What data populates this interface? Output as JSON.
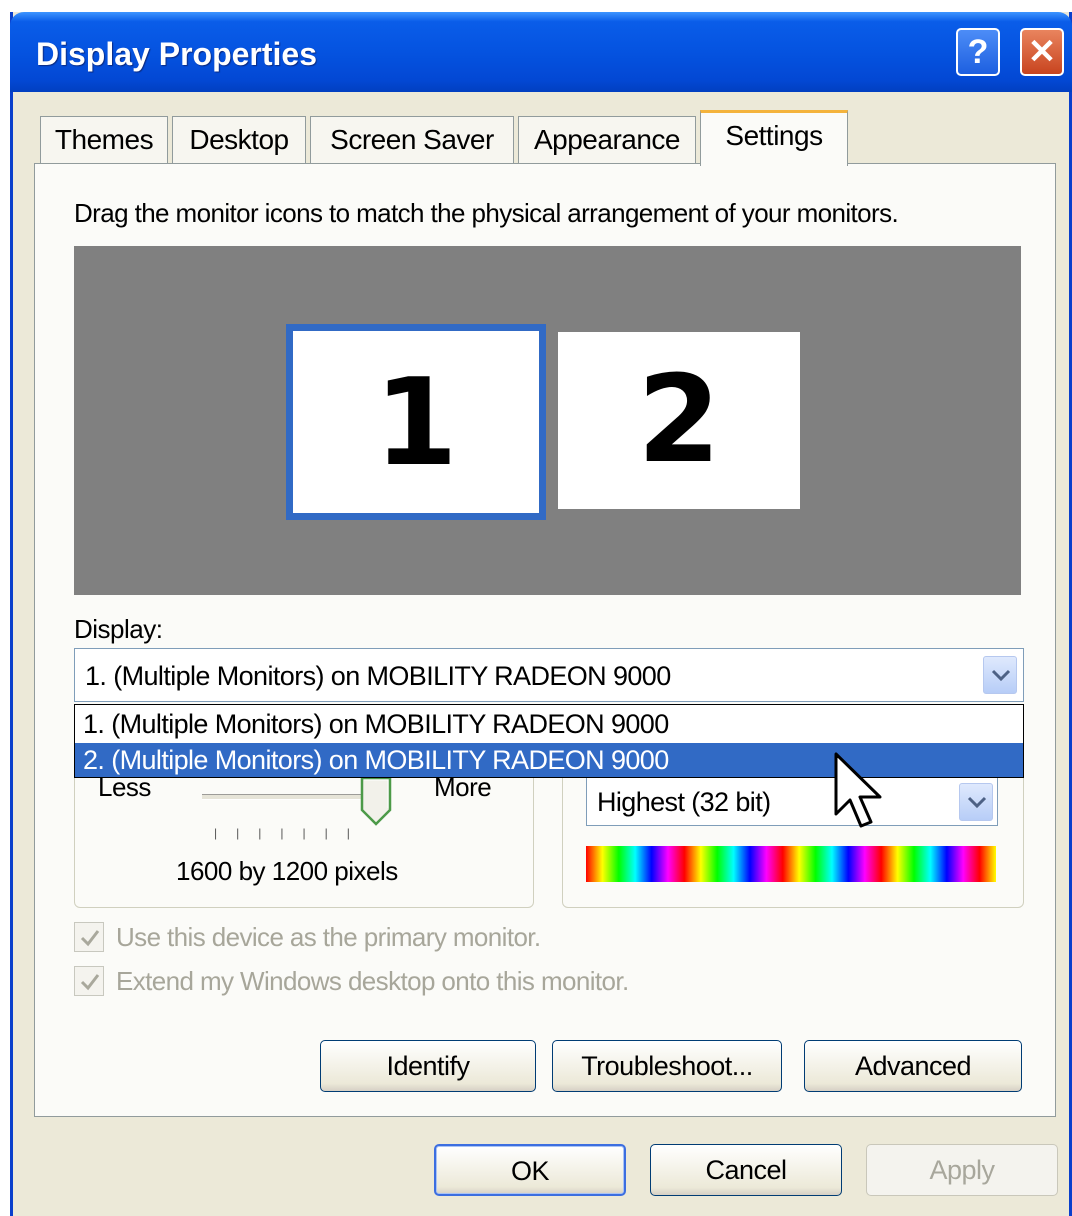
{
  "window": {
    "title": "Display Properties"
  },
  "titlebar_buttons": {
    "help": "?",
    "close": "✕"
  },
  "tabs": [
    "Themes",
    "Desktop",
    "Screen Saver",
    "Appearance",
    "Settings"
  ],
  "active_tab": "Settings",
  "instruction": "Drag the monitor icons to match the physical arrangement of your monitors.",
  "monitors": [
    "1",
    "2"
  ],
  "display": {
    "label": "Display:",
    "selected": "1. (Multiple Monitors) on MOBILITY RADEON 9000",
    "options": [
      "1. (Multiple Monitors) on MOBILITY RADEON 9000",
      "2. (Multiple Monitors) on MOBILITY RADEON 9000"
    ],
    "highlighted_option": "2. (Multiple Monitors) on MOBILITY RADEON 9000"
  },
  "resolution": {
    "less": "Less",
    "more": "More",
    "value": "1600 by 1200 pixels"
  },
  "color_quality": {
    "selected": "Highest (32 bit)"
  },
  "checkboxes": [
    {
      "label": "Use this device as the primary monitor.",
      "checked": true,
      "enabled": false
    },
    {
      "label": "Extend my Windows desktop onto this monitor.",
      "checked": true,
      "enabled": false
    }
  ],
  "buttons": {
    "identify": "Identify",
    "troubleshoot": "Troubleshoot...",
    "advanced": "Advanced"
  },
  "dialog_buttons": {
    "ok": "OK",
    "cancel": "Cancel",
    "apply": "Apply"
  },
  "colors": {
    "titlebar": "#0553e0",
    "selection": "#316ac5",
    "tab_highlight": "#f4b33c",
    "face": "#ece9d8"
  }
}
